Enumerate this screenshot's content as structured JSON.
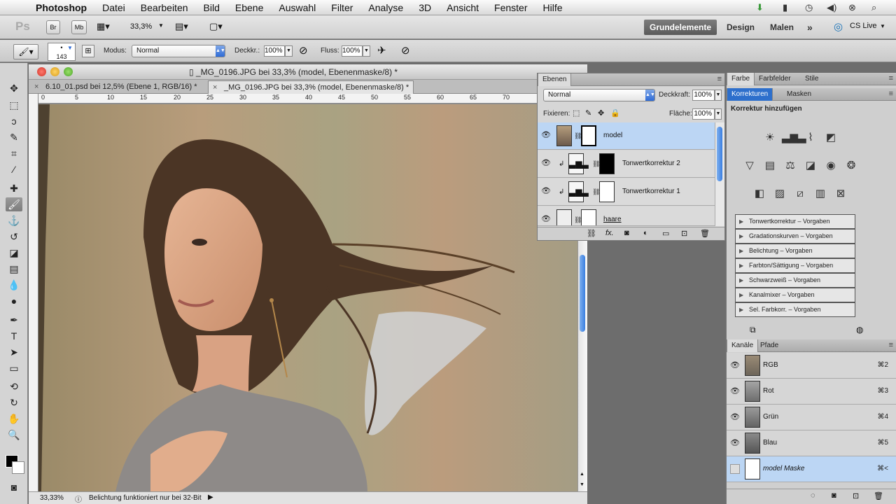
{
  "menubar": {
    "app": "Photoshop",
    "items": [
      "Datei",
      "Bearbeiten",
      "Bild",
      "Ebene",
      "Auswahl",
      "Filter",
      "Analyse",
      "3D",
      "Ansicht",
      "Fenster",
      "Hilfe"
    ]
  },
  "appbar": {
    "logo": "Ps",
    "br": "Br",
    "mb": "Mb",
    "zoom": "33,3%",
    "workspaces": [
      "Grundelemente",
      "Design",
      "Malen"
    ],
    "more": "»",
    "cslive": "CS Live"
  },
  "options": {
    "brush_size": "143",
    "mode_label": "Modus:",
    "mode_value": "Normal",
    "opacity_label": "Deckkr.:",
    "opacity_value": "100%",
    "flow_label": "Fluss:",
    "flow_value": "100%"
  },
  "document": {
    "title": "_MG_0196.JPG bei 33,3% (model, Ebenenmaske/8) *",
    "tabs": [
      {
        "label": "6.10_01.psd bei 12,5% (Ebene 1, RGB/16) *"
      },
      {
        "label": "_MG_0196.JPG bei 33,3% (model, Ebenenmaske/8) *"
      }
    ],
    "ruler_numbers": [
      "0",
      "5",
      "10",
      "15",
      "20",
      "25",
      "30",
      "35",
      "40",
      "45",
      "50",
      "55",
      "60",
      "65",
      "70"
    ],
    "status_zoom": "33,33%",
    "status_text": "Belichtung funktioniert nur bei 32-Bit"
  },
  "layers": {
    "tab": "Ebenen",
    "blend_mode": "Normal",
    "opacity_label": "Deckkraft:",
    "opacity_value": "100%",
    "lock_label": "Fixieren:",
    "fill_label": "Fläche:",
    "fill_value": "100%",
    "items": [
      {
        "name": "model"
      },
      {
        "name": "Tonwertkorrektur 2"
      },
      {
        "name": "Tonwertkorrektur 1"
      },
      {
        "name": "haare"
      }
    ],
    "footer_fx": "fx."
  },
  "right": {
    "tabs_top": [
      "Farbe",
      "Farbfelder",
      "Stile"
    ],
    "tabs_mid": [
      "Korrekturen",
      "Masken"
    ],
    "heading": "Korrektur hinzufügen",
    "presets": [
      "Tonwertkorrektur – Vorgaben",
      "Gradationskurven – Vorgaben",
      "Belichtung – Vorgaben",
      "Farbton/Sättigung – Vorgaben",
      "Schwarzweiß – Vorgaben",
      "Kanalmixer – Vorgaben",
      "Sel. Farbkorr. – Vorgaben"
    ],
    "tabs_bottom": [
      "Kanäle",
      "Pfade"
    ],
    "channels": [
      {
        "name": "RGB",
        "key": "⌘2"
      },
      {
        "name": "Rot",
        "key": "⌘3"
      },
      {
        "name": "Grün",
        "key": "⌘4"
      },
      {
        "name": "Blau",
        "key": "⌘5"
      },
      {
        "name": "model Maske",
        "key": "⌘<"
      }
    ]
  }
}
